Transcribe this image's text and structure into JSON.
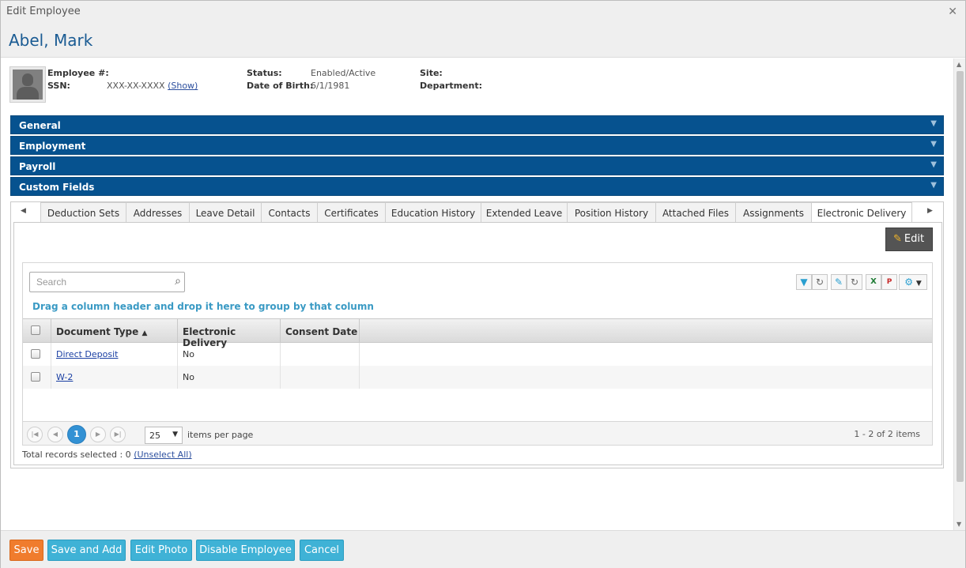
{
  "window": {
    "title": "Edit Employee"
  },
  "employee": {
    "name": "Abel, Mark",
    "fields": {
      "employee_num_label": "Employee #:",
      "employee_num_value": "",
      "ssn_label": "SSN:",
      "ssn_value": "XXX-XX-XXXX",
      "ssn_show": "(Show)",
      "status_label": "Status:",
      "status_value": "Enabled/Active",
      "dob_label": "Date of Birth:",
      "dob_value": "6/1/1981",
      "site_label": "Site:",
      "site_value": "",
      "department_label": "Department:",
      "department_value": ""
    }
  },
  "sections": [
    {
      "label": "General"
    },
    {
      "label": "Employment"
    },
    {
      "label": "Payroll"
    },
    {
      "label": "Custom Fields"
    }
  ],
  "tabs": [
    {
      "label": "Deduction Sets"
    },
    {
      "label": "Addresses"
    },
    {
      "label": "Leave Detail"
    },
    {
      "label": "Contacts"
    },
    {
      "label": "Certificates"
    },
    {
      "label": "Education History"
    },
    {
      "label": "Extended Leave"
    },
    {
      "label": "Position History"
    },
    {
      "label": "Attached Files"
    },
    {
      "label": "Assignments"
    },
    {
      "label": "Electronic Delivery",
      "active": true
    }
  ],
  "content": {
    "edit_label": "Edit",
    "search_placeholder": "Search",
    "group_hint": "Drag a column header and drop it here to group by that column",
    "columns": [
      "Document Type",
      "Electronic Delivery",
      "Consent Date"
    ],
    "sort_indicator": "▲",
    "rows": [
      {
        "document_type": "Direct Deposit",
        "electronic_delivery": "No",
        "consent_date": ""
      },
      {
        "document_type": "W-2",
        "electronic_delivery": "No",
        "consent_date": ""
      }
    ],
    "pager": {
      "current_page": "1",
      "page_size": "25",
      "items_per_page_label": "items per page",
      "range": "1 - 2 of 2 items"
    },
    "total_selected": "Total records selected : 0",
    "unselect_all": "(Unselect All)"
  },
  "icons": {
    "filter": "filter-icon",
    "refresh": "refresh-icon",
    "wrench": "wrench-icon",
    "excel": "excel-icon",
    "pdf": "pdf-icon",
    "gear": "gear-icon"
  },
  "colors": {
    "section_bar": "#06528f",
    "name": "#1a5b93",
    "save": "#f07c2d",
    "footer_button": "#3fb2d6",
    "pager_current": "#3291d4",
    "group_hint": "#3a9ac4"
  },
  "footer": {
    "save": "Save",
    "save_add": "Save and Add",
    "edit_photo": "Edit Photo",
    "disable": "Disable Employee",
    "cancel": "Cancel"
  }
}
